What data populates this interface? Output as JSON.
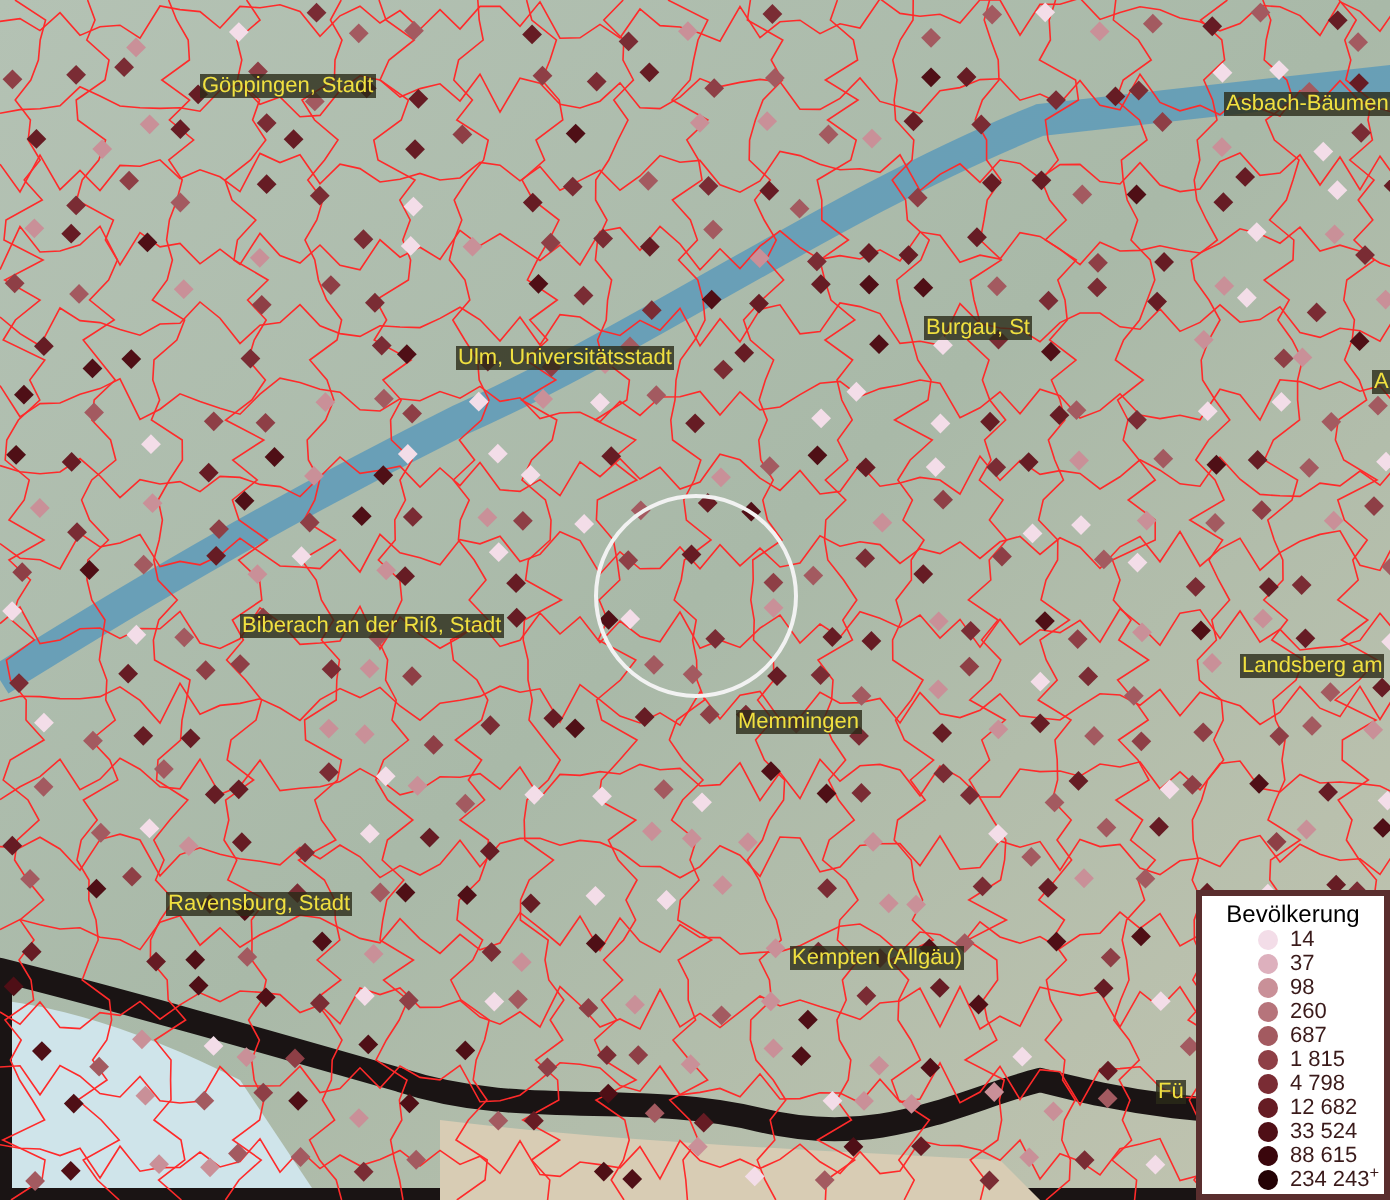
{
  "map": {
    "labels": [
      {
        "text": "Göppingen, Stadt"
      },
      {
        "text": "Asbach-Bäumen"
      },
      {
        "text": "Ulm, Universitätsstadt"
      },
      {
        "text": "Burgau, St"
      },
      {
        "text": "A"
      },
      {
        "text": "Biberach an der Riß, Stadt"
      },
      {
        "text": "Landsberg am"
      },
      {
        "text": "Memmingen"
      },
      {
        "text": "Ravensburg, Stadt"
      },
      {
        "text": "Kempten (Allgäu)"
      },
      {
        "text": "Fü"
      }
    ]
  },
  "legend": {
    "title": "Bevölkerung",
    "items": [
      {
        "label": "14",
        "color": "#f3dde8"
      },
      {
        "label": "37",
        "color": "#ddb0bd"
      },
      {
        "label": "98",
        "color": "#c99098"
      },
      {
        "label": "260",
        "color": "#b6747b"
      },
      {
        "label": "687",
        "color": "#a35a60"
      },
      {
        "label": "1 815",
        "color": "#8e3f46"
      },
      {
        "label": "4 798",
        "color": "#7a2c34"
      },
      {
        "label": "12 682",
        "color": "#661c24"
      },
      {
        "label": "33 524",
        "color": "#4f0f16"
      },
      {
        "label": "88 615",
        "color": "#3a060c"
      },
      {
        "label": "234 243$^{+}$",
        "color": "#240205"
      }
    ]
  }
}
